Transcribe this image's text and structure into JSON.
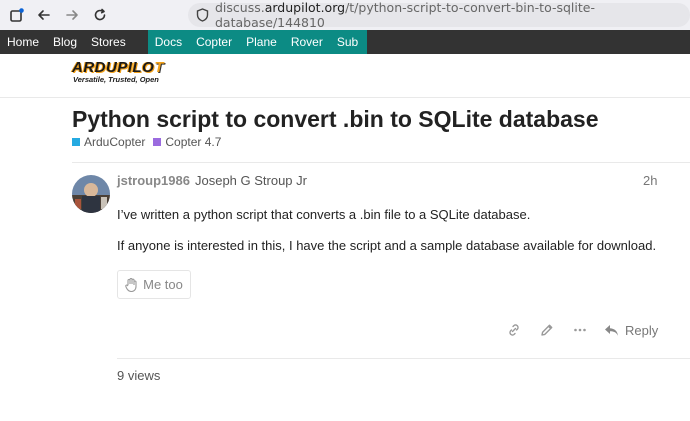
{
  "browser": {
    "url_domain": "discuss.",
    "url_host": "ardupilot.org",
    "url_path": "/t/python-script-to-convert-bin-to-sqlite-database/144810"
  },
  "nav": {
    "left": [
      "Home",
      "Blog",
      "Stores"
    ],
    "right": [
      "Docs",
      "Copter",
      "Plane",
      "Rover",
      "Sub"
    ]
  },
  "logo": {
    "word_main": "ARDUPILO",
    "word_end": "T",
    "tagline": "Versatile, Trusted, Open"
  },
  "topic": {
    "title": "Python script to convert .bin to SQLite database",
    "categories": [
      {
        "label": "ArduCopter",
        "color": "#25aae1"
      },
      {
        "label": "Copter 4.7",
        "color": "#9b6bdf"
      }
    ]
  },
  "post": {
    "username": "jstroup1986",
    "fullname": "Joseph G Stroup Jr",
    "age": "2h",
    "paragraphs": [
      "I’ve written a python script that converts a .bin file to a SQLite database.",
      "If anyone is interested in this, I have the script and a sample database available for download."
    ],
    "metoo_label": "Me too",
    "reply_label": "Reply"
  },
  "footer": {
    "views": "9 views"
  },
  "colors": {
    "accent_teal": "#0c8b84",
    "nav_dark": "#333333"
  }
}
